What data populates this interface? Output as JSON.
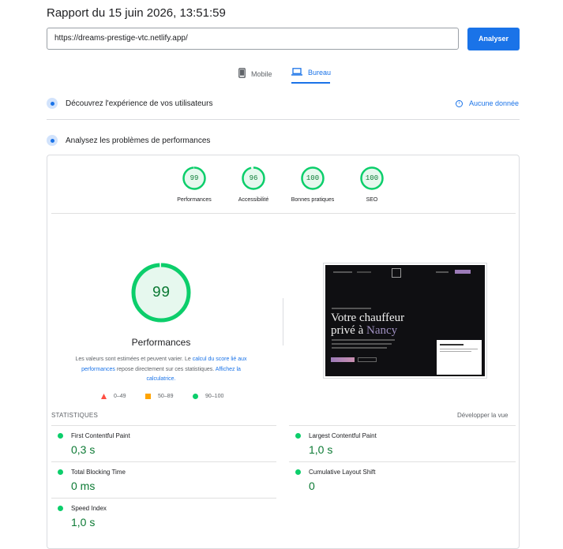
{
  "report": {
    "title": "Rapport du 15 juin 2026, 13:51:59",
    "url": "https://dreams-prestige-vtc.netlify.app/",
    "analyze_label": "Analyser"
  },
  "tabs": [
    {
      "label": "Mobile",
      "icon": "phone-icon",
      "active": false
    },
    {
      "label": "Bureau",
      "icon": "laptop-icon",
      "active": true
    }
  ],
  "sections": {
    "field": {
      "label": "Découvrez l'expérience de vos utilisateurs",
      "no_data": "Aucune donnée"
    },
    "lab": {
      "label": "Analysez les problèmes de performances"
    }
  },
  "scores": [
    {
      "value": "99",
      "label": "Performances",
      "fraction": 0.99
    },
    {
      "value": "96",
      "label": "Accessibilité",
      "fraction": 0.96
    },
    {
      "value": "100",
      "label": "Bonnes pratiques",
      "fraction": 1.0
    },
    {
      "value": "100",
      "label": "SEO",
      "fraction": 1.0
    }
  ],
  "main_score": {
    "value": "99",
    "fraction": 0.99,
    "label": "Performances",
    "desc_prefix": "Les valeurs sont estimées et peuvent varier. Le ",
    "desc_link1": "calcul du score lié aux performances",
    "desc_middle": " repose directement sur ces statistiques. ",
    "desc_link2": "Affichez la calculatrice."
  },
  "legend": [
    {
      "range": "0–49",
      "color": "#ff4e42",
      "shape": "triangle"
    },
    {
      "range": "50–89",
      "color": "#ffa400",
      "shape": "square"
    },
    {
      "range": "90–100",
      "color": "#0cce6b",
      "shape": "circle"
    }
  ],
  "screenshot": {
    "headline_1": "Votre chauffeur",
    "headline_2": "privé à",
    "headline_city": "Nancy"
  },
  "stats": {
    "heading": "STATISTIQUES",
    "expand": "Développer la vue",
    "metrics": [
      {
        "name": "First Contentful Paint",
        "value": "0,3 s"
      },
      {
        "name": "Largest Contentful Paint",
        "value": "1,0 s"
      },
      {
        "name": "Total Blocking Time",
        "value": "0 ms"
      },
      {
        "name": "Cumulative Layout Shift",
        "value": "0"
      },
      {
        "name": "Speed Index",
        "value": "1,0 s"
      }
    ]
  },
  "colors": {
    "accent": "#1a73e8",
    "pass": "#0cce6b",
    "pass_text": "#0c7a34"
  }
}
